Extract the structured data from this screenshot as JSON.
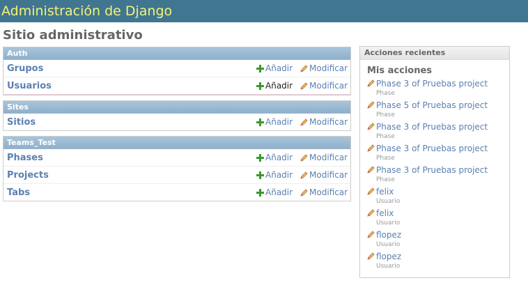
{
  "header": {
    "branding": "Administración de Django"
  },
  "page": {
    "title": "Sitio administrativo"
  },
  "modules": [
    {
      "caption": "Auth",
      "models": [
        {
          "name": "Grupos",
          "add": "Añadir",
          "change": "Modificar"
        },
        {
          "name": "Usuarios",
          "add": "Añadir",
          "change": "Modificar"
        }
      ]
    },
    {
      "caption": "Sites",
      "models": [
        {
          "name": "Sitios",
          "add": "Añadir",
          "change": "Modificar"
        }
      ]
    },
    {
      "caption": "Teams_Test",
      "models": [
        {
          "name": "Phases",
          "add": "Añadir",
          "change": "Modificar"
        },
        {
          "name": "Projects",
          "add": "Añadir",
          "change": "Modificar"
        },
        {
          "name": "Tabs",
          "add": "Añadir",
          "change": "Modificar"
        }
      ]
    }
  ],
  "sidebar": {
    "caption": "Acciones recientes",
    "heading": "Mis acciones",
    "actions": [
      {
        "label": "Phase 3 of Pruebas project",
        "type": "Phase"
      },
      {
        "label": "Phase 5 of Pruebas project",
        "type": "Phase"
      },
      {
        "label": "Phase 3 of Pruebas project",
        "type": "Phase"
      },
      {
        "label": "Phase 3 of Pruebas project",
        "type": "Phase"
      },
      {
        "label": "Phase 3 of Pruebas project",
        "type": "Phase"
      },
      {
        "label": "felix",
        "type": "Usuario"
      },
      {
        "label": "felix",
        "type": "Usuario"
      },
      {
        "label": "flopez",
        "type": "Usuario"
      },
      {
        "label": "flopez",
        "type": "Usuario"
      }
    ]
  },
  "colors": {
    "header_bg": "#417690",
    "branding": "#f4f379",
    "link": "#5b80b2",
    "add_icon": "#3a9a2a"
  }
}
